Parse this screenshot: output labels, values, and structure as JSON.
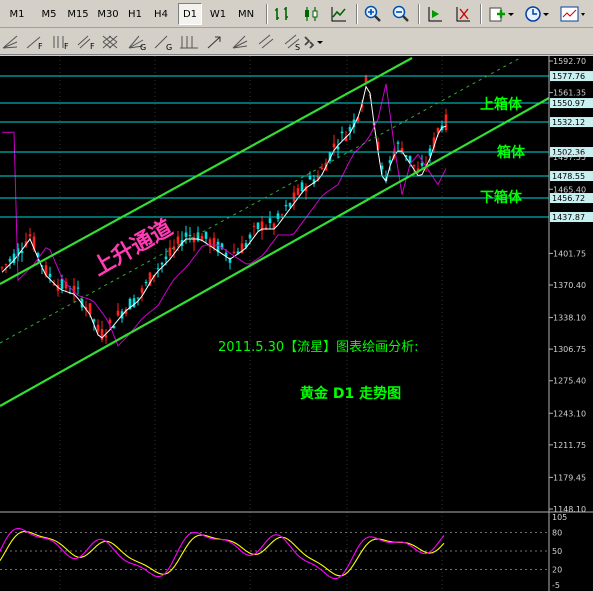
{
  "toolbar": {
    "timeframes": [
      "M1",
      "M5",
      "M15",
      "M30",
      "H1",
      "H4",
      "D1",
      "W1",
      "MN"
    ],
    "active_timeframe": "D1"
  },
  "price_axis": {
    "labels": [
      "1592.70",
      "1561.35",
      "1497.55",
      "1465.40",
      "1401.75",
      "1370.40",
      "1338.10",
      "1306.75",
      "1275.40",
      "1243.10",
      "1211.75",
      "1179.45",
      "1148.10"
    ],
    "highlighted": [
      "1577.76",
      "1550.97",
      "1532.12",
      "1502.36",
      "1478.55",
      "1456.72",
      "1437.87"
    ]
  },
  "annotations": {
    "upper_box": "上箱体",
    "box": "箱体",
    "lower_box": "下箱体",
    "channel": "上升通道",
    "title_line": "2011.5.30【流星】图表绘画分析:",
    "subtitle_line": "黄金 D1 走势图"
  },
  "oscillator": {
    "levels": [
      "105",
      "80",
      "50",
      "20",
      "-5"
    ],
    "colors": {
      "main": "#ff00ff",
      "signal": "#ffff00"
    }
  },
  "colors": {
    "channel_lines": "#33dd33",
    "horizontal_levels": "#00d7d7",
    "bull_candle": "#ff2020",
    "bear_candle": "#00e0e0",
    "ma_fast": "#ffffff",
    "ma_slow": "#cc00cc"
  }
}
